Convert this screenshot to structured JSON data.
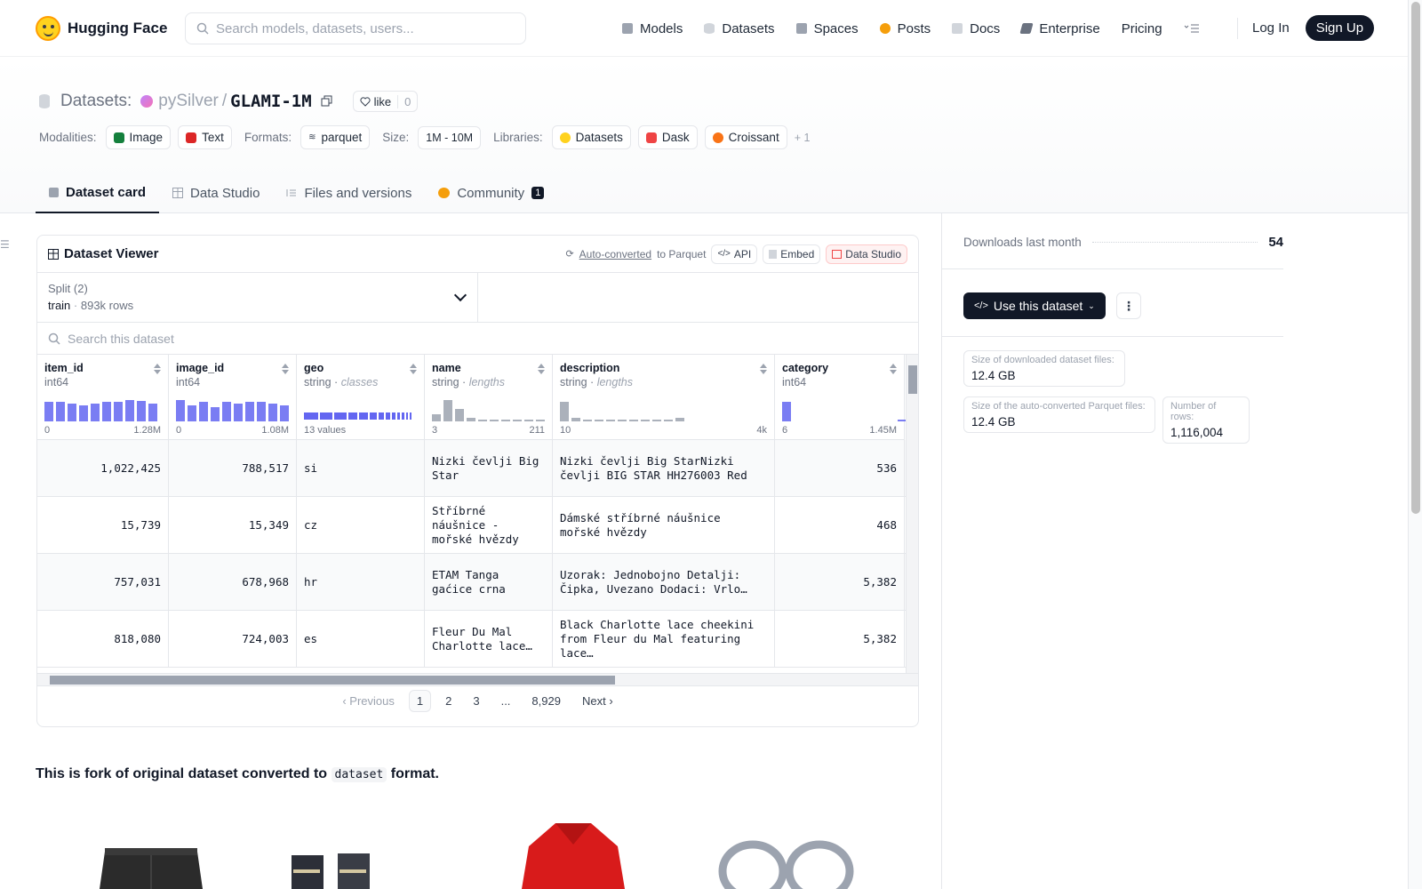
{
  "nav": {
    "brand": "Hugging Face",
    "search_placeholder": "Search models, datasets, users...",
    "links": [
      {
        "label": "Models",
        "color": "#9ca3af"
      },
      {
        "label": "Datasets",
        "color": "#d1d5db"
      },
      {
        "label": "Spaces",
        "color": "#9ca3af"
      },
      {
        "label": "Posts",
        "color": "#f59e0b"
      },
      {
        "label": "Docs",
        "color": "#d1d5db"
      },
      {
        "label": "Enterprise",
        "color": "#6b7280"
      },
      {
        "label": "Pricing",
        "color": ""
      }
    ],
    "login": "Log In",
    "signup": "Sign Up"
  },
  "header": {
    "prefix": "Datasets:",
    "owner": "pySilver",
    "slash": "/",
    "name": "GLAMI-1M",
    "like_label": "like",
    "like_count": "0",
    "modalities_label": "Modalities:",
    "modalities": [
      "Image",
      "Text"
    ],
    "formats_label": "Formats:",
    "format": "parquet",
    "size_label": "Size:",
    "size": "1M - 10M",
    "libraries_label": "Libraries:",
    "libraries": [
      "Datasets",
      "Dask",
      "Croissant"
    ],
    "libraries_more": "+ 1"
  },
  "tabs": [
    {
      "label": "Dataset card",
      "active": true
    },
    {
      "label": "Data Studio"
    },
    {
      "label": "Files and versions"
    },
    {
      "label": "Community",
      "badge": "1"
    }
  ],
  "viewer": {
    "title": "Dataset Viewer",
    "auto_converted": "Auto-converted",
    "to_parquet": "to Parquet",
    "api": "API",
    "embed": "Embed",
    "data_studio": "Data Studio",
    "split_label": "Split (2)",
    "split_value": "train",
    "split_rows": "893k rows",
    "search_placeholder": "Search this dataset",
    "columns": [
      {
        "name": "item_id",
        "type": "int64",
        "kind": "",
        "min": "0",
        "max": "1.28M"
      },
      {
        "name": "image_id",
        "type": "int64",
        "kind": "",
        "min": "0",
        "max": "1.08M"
      },
      {
        "name": "geo",
        "type": "string",
        "kind": "classes",
        "min": "13 values",
        "max": ""
      },
      {
        "name": "name",
        "type": "string",
        "kind": "lengths",
        "min": "3",
        "max": "211"
      },
      {
        "name": "description",
        "type": "string",
        "kind": "lengths",
        "min": "10",
        "max": "4k"
      },
      {
        "name": "category",
        "type": "int64",
        "kind": "",
        "min": "6",
        "max": "1.45M"
      }
    ],
    "rows": [
      [
        "1,022,425",
        "788,517",
        "si",
        "Nizki čevlji Big Star",
        "Nizki čevlji Big StarNizki čevlji BIG STAR HH276003 Red",
        "536"
      ],
      [
        "15,739",
        "15,349",
        "cz",
        "Stříbrné náušnice - mořské hvězdy",
        "Dámské stříbrné náušnice mořské hvězdy",
        "468"
      ],
      [
        "757,031",
        "678,968",
        "hr",
        "ETAM Tanga gaćice crna",
        "Uzorak: Jednobojno Detalji: Čipka, Uvezano Dodaci: Vrlo…",
        "5,382"
      ],
      [
        "818,080",
        "724,003",
        "es",
        "Fleur Du Mal Charlotte lace…",
        "Black Charlotte lace cheekini from Fleur du Mal featuring lace…",
        "5,382"
      ]
    ],
    "pager": {
      "prev": "Previous",
      "pages": [
        "1",
        "2",
        "3",
        "...",
        "8,929"
      ],
      "next": "Next"
    }
  },
  "sidebar": {
    "downloads_label": "Downloads last month",
    "downloads": "54",
    "use_button": "Use this dataset",
    "stats": [
      {
        "k": "Size of downloaded dataset files:",
        "v": "12.4 GB"
      },
      {
        "k": "Size of the auto-converted Parquet files:",
        "v": "12.4 GB"
      },
      {
        "k": "Number of rows:",
        "v": "1,116,004"
      }
    ]
  },
  "card": {
    "before": "This is fork of original dataset converted to",
    "code": "dataset",
    "after": "format."
  }
}
